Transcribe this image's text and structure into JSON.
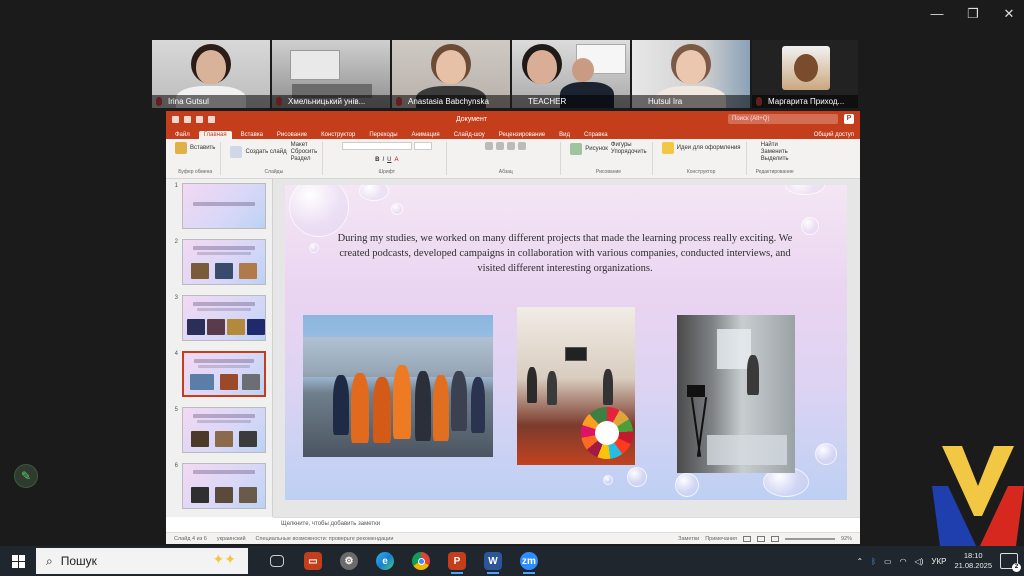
{
  "window_controls": {
    "minimize": "—",
    "restore": "❐",
    "close": "✕"
  },
  "participants": [
    {
      "name": "Irina Gutsul",
      "muted": true,
      "active": false
    },
    {
      "name": "Хмельницький унів...",
      "muted": true,
      "active": false
    },
    {
      "name": "Anastasia Babchynska",
      "muted": true,
      "active": false
    },
    {
      "name": "TEACHER",
      "muted": false,
      "active": false
    },
    {
      "name": "Hutsul Ira",
      "muted": false,
      "active": true
    },
    {
      "name": "Маргарита Приход...",
      "muted": true,
      "active": false
    }
  ],
  "powerpoint": {
    "file_name": "Документ",
    "search_placeholder": "Поиск (Alt+Q)",
    "app_letter": "P",
    "tabs": [
      "Файл",
      "Главная",
      "Вставка",
      "Рисование",
      "Конструктор",
      "Переходы",
      "Анимация",
      "Слайд-шоу",
      "Рецензирование",
      "Вид",
      "Справка"
    ],
    "selected_tab": "Главная",
    "share_label": "Общий доступ",
    "ribbon_groups": [
      {
        "label": "Буфер обмена",
        "buttons": [
          "Вставить"
        ]
      },
      {
        "label": "Слайды",
        "buttons": [
          "Создать слайд",
          "Макет",
          "Сбросить",
          "Раздел"
        ]
      },
      {
        "label": "Шрифт",
        "buttons": [
          "Шрифт"
        ]
      },
      {
        "label": "Абзац",
        "buttons": [
          "Абзац"
        ]
      },
      {
        "label": "Рисование",
        "buttons": [
          "Рисунок",
          "Фигуры",
          "Упорядочить"
        ]
      },
      {
        "label": "Конструктор",
        "buttons": [
          "Идеи для оформления"
        ]
      },
      {
        "label": "Редактирование",
        "buttons": [
          "Найти",
          "Заменить",
          "Выделить"
        ]
      }
    ],
    "slide_numbers": [
      "1",
      "2",
      "3",
      "4",
      "5",
      "6"
    ],
    "selected_slide": 4,
    "slide_text": "During my studies, we worked on many different projects that made the learning process really exciting. We created podcasts, developed campaigns in collaboration with various companies, conducted interviews, and visited different interesting organizations.",
    "notes_placeholder": "Щелкните, чтобы добавить заметки",
    "status": {
      "slide_counter": "Слайд 4 из 6",
      "language": "украинский",
      "accessibility": "Специальные возможности: проверьте рекомендации",
      "notes": "Заметки",
      "comments": "Примечания",
      "zoom": "92%"
    }
  },
  "chat_icon": "chat-icon",
  "taskbar": {
    "search_label": "Пошук",
    "apps": [
      "task-view",
      "powerpoint-files",
      "settings",
      "edge",
      "chrome",
      "powerpoint",
      "word",
      "zoom"
    ],
    "language": "УКР",
    "time": "18:10",
    "date": "21.08.2025",
    "notification_count": "2"
  },
  "colors": {
    "ppt_accent": "#c43e1c",
    "active_speaker": "#48c774",
    "taskbar": "#20262e"
  }
}
